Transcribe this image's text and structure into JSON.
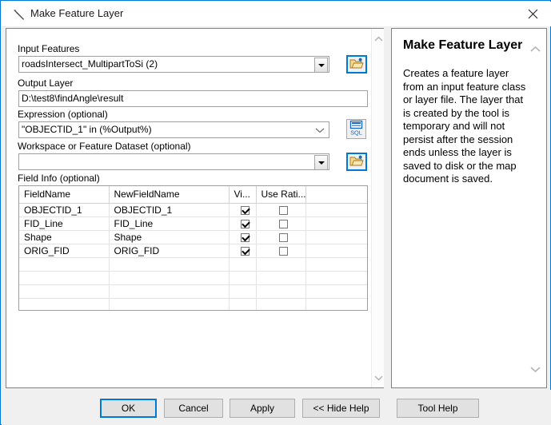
{
  "window": {
    "title": "Make Feature Layer",
    "title_icon": "hammer-tool-icon",
    "close_icon": "close-icon",
    "accent_color": "#0078d7"
  },
  "form": {
    "input_features": {
      "label": "Input Features",
      "value": "roadsIntersect_MultipartToSi (2)",
      "browse_icon": "open-folder-icon"
    },
    "output_layer": {
      "label": "Output Layer",
      "value": "D:\\test8\\findAngle\\result"
    },
    "expression": {
      "label": "Expression (optional)",
      "value": "\"OBJECTID_1\" in (%Output%)",
      "sql_icon": "sql-builder-icon",
      "sql_label": "SQL"
    },
    "workspace": {
      "label": "Workspace or Feature Dataset (optional)",
      "value": "",
      "browse_icon": "open-folder-icon"
    },
    "field_info": {
      "label": "Field Info (optional)",
      "columns": [
        "FieldName",
        "NewFieldName",
        "Vi...",
        "Use Rati...",
        ""
      ],
      "rows": [
        {
          "field_name": "OBJECTID_1",
          "new_field_name": "OBJECTID_1",
          "visible": true,
          "use_ratio": false
        },
        {
          "field_name": "FID_Line",
          "new_field_name": "FID_Line",
          "visible": true,
          "use_ratio": false
        },
        {
          "field_name": "Shape",
          "new_field_name": "Shape",
          "visible": true,
          "use_ratio": false
        },
        {
          "field_name": "ORIG_FID",
          "new_field_name": "ORIG_FID",
          "visible": true,
          "use_ratio": false
        }
      ],
      "empty_rows": 5
    }
  },
  "help": {
    "title": "Make Feature Layer",
    "body": "Creates a feature layer from an input feature class or layer file. The layer that is created by the tool is temporary and will not persist after the session ends unless the layer is saved to disk or the map document is saved.",
    "scroll_up_icon": "chevron-up-icon",
    "scroll_down_icon": "chevron-down-icon"
  },
  "scrollbar": {
    "up_icon": "chevron-up-icon",
    "down_icon": "chevron-down-icon"
  },
  "footer": {
    "ok": "OK",
    "cancel": "Cancel",
    "apply": "Apply",
    "hide_help": "<< Hide Help",
    "tool_help": "Tool Help"
  }
}
